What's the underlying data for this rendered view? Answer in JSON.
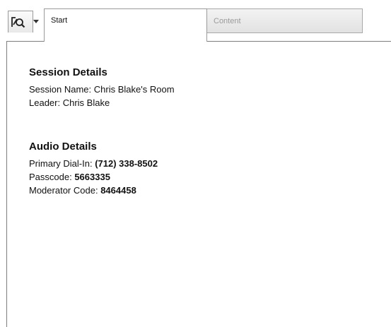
{
  "toolbar": {
    "tool_icon": "search-page-icon",
    "dropdown_icon": "chevron-down-icon"
  },
  "tabs": [
    {
      "label": "Start",
      "selected": true
    },
    {
      "label": "Content",
      "selected": false
    }
  ],
  "session": {
    "heading": "Session Details",
    "name_label": "Session Name:",
    "name_value": "Chris Blake's Room",
    "leader_label": "Leader:",
    "leader_value": "Chris Blake"
  },
  "audio": {
    "heading": "Audio Details",
    "dialin_label": "Primary Dial-In:",
    "dialin_value": "(712) 338-8502",
    "passcode_label": "Passcode:",
    "passcode_value": "5663335",
    "moderator_label": "Moderator Code:",
    "moderator_value": "8464458"
  }
}
